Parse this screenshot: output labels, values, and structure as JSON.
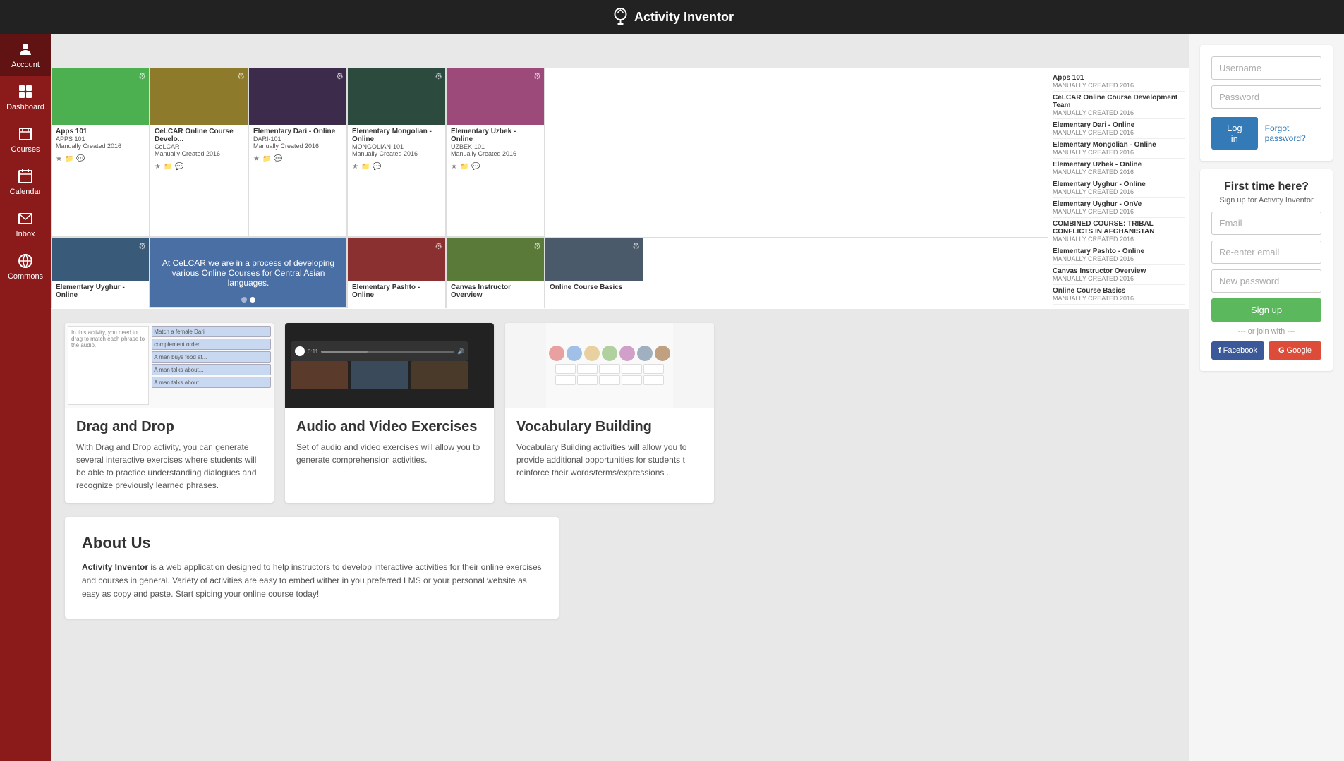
{
  "app": {
    "title": "Activity Inventor",
    "logo_text": "Activity Inventor"
  },
  "sidebar": {
    "items": [
      {
        "label": "Account",
        "icon": "account-icon"
      },
      {
        "label": "Dashboard",
        "icon": "dashboard-icon"
      },
      {
        "label": "Courses",
        "icon": "courses-icon"
      },
      {
        "label": "Calendar",
        "icon": "calendar-icon"
      },
      {
        "label": "Inbox",
        "icon": "inbox-icon"
      },
      {
        "label": "Commons",
        "icon": "commons-icon"
      }
    ]
  },
  "courses": {
    "row1": [
      {
        "title": "Apps 101",
        "subtitle": "APPS 101",
        "created": "Manually Created 2016",
        "color": "#4caf50"
      },
      {
        "title": "CeLCAR Online Course Develo...",
        "subtitle": "CeLCAR",
        "created": "Manually Created 2016",
        "color": "#8d7b2b"
      },
      {
        "title": "Elementary Dari - Online",
        "subtitle": "DARI-101",
        "created": "Manually Created 2016",
        "color": "#3d2b4c"
      },
      {
        "title": "Elementary Mongolian - Online",
        "subtitle": "MONGOLIAN-101",
        "created": "Manually Created 2016",
        "color": "#2c4a3e"
      },
      {
        "title": "Elementary Uzbek - Online",
        "subtitle": "UZBEK-101",
        "created": "Manually Created 2016",
        "color": "#4a5a6a"
      }
    ],
    "row2_cards": [
      {
        "title": "Elementary Uyghur - Online",
        "color": "#3a4a5c"
      },
      {
        "title": "COMBINED COURSE: TRIBAL",
        "color": "#5a7a3a"
      },
      {
        "title": "Elementary Pashto - Online",
        "color": "#7a3a3a"
      },
      {
        "title": "Canvas Instructor Overview",
        "color": "#3a5a7a"
      },
      {
        "title": "Online Course Basics",
        "color": "#5a3a7a"
      }
    ],
    "banner": {
      "text": "At CeLCAR we are in a process of developing various Online Courses for Central Asian languages.",
      "dots": 2,
      "active_dot": 1
    }
  },
  "right_list": {
    "items": [
      {
        "title": "Apps 101",
        "sub": "MANUALLY CREATED 2016"
      },
      {
        "title": "CeLCAR Online Course Development Team",
        "sub": "MANUALLY CREATED 2016"
      },
      {
        "title": "Elementary Dari - Online",
        "sub": "MANUALLY CREATED 2016"
      },
      {
        "title": "Elementary Mongolian - Online",
        "sub": "MANUALLY CREATED 2016"
      },
      {
        "title": "Elementary Uzbek - Online",
        "sub": "MANUALLY CREATED 2016"
      },
      {
        "title": "Elementary Uyghur - Online",
        "sub": "MANUALLY CREATED 2016"
      },
      {
        "title": "Elementary Uyghur - OnVe",
        "sub": "MANUALLY CREATED 2016"
      },
      {
        "title": "COMBINED COURSE: TRIBAL CONFLICTS IN AFGHANISTAN",
        "sub": "MANUALLY CREATED 2016"
      },
      {
        "title": "Elementary Pashto - Online",
        "sub": "MANUALLY CREATED 2016"
      },
      {
        "title": "Canvas Instructor Overview",
        "sub": "MANUALLY CREATED 2016"
      },
      {
        "title": "Online Course Basics",
        "sub": "MANUALLY CREATED 2016"
      }
    ]
  },
  "features": [
    {
      "title": "Drag and Drop",
      "description": "With Drag and Drop activity, you can generate several interactive exercises where students will be able to practice understanding dialogues and recognize previously learned phrases.",
      "preview_type": "drag-drop"
    },
    {
      "title": "Audio and Video Exercises",
      "description": "Set of audio and video exercises will allow you to generate comprehension activities.",
      "preview_type": "audio-video"
    },
    {
      "title": "Vocabulary Building",
      "description": "Vocabulary Building activities will allow you to provide additional opportunities for students t reinforce their words/terms/expressions .",
      "preview_type": "vocabulary"
    }
  ],
  "about": {
    "title": "About Us",
    "text_prefix": "Activity Inventor",
    "text_suffix": " is a web application designed to help instructors to develop interactive activities for their online exercises and courses in general. Variety of activities are easy to embed wither in you preferred LMS or your personal website as easy as copy and paste. Start spicing your online course today!"
  },
  "login": {
    "username_placeholder": "Username",
    "password_placeholder": "Password",
    "login_label": "Log in",
    "forgot_label": "Forgot password?"
  },
  "signup": {
    "title": "First time here?",
    "subtitle": "Sign up for Activity Inventor",
    "email_placeholder": "Email",
    "re_email_placeholder": "Re-enter email",
    "password_placeholder": "New password",
    "signup_label": "Sign up",
    "or_text": "--- or join with ---",
    "facebook_label": "Facebook",
    "google_label": "Google"
  }
}
